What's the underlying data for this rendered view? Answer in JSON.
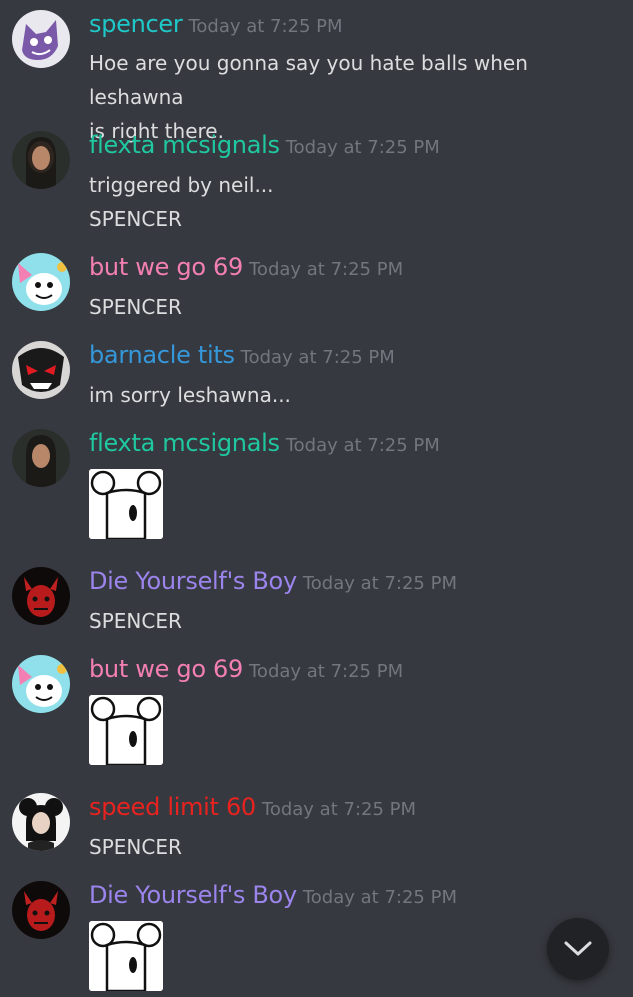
{
  "messages": [
    {
      "username": "spencer",
      "color": "#1fc8c8",
      "timestamp": "Today at 7:25 PM",
      "lines": [
        "Hoe are you gonna say you hate balls when leshawna",
        "is right there."
      ],
      "avatar": "purple-cat-avatar"
    },
    {
      "username": "flexta mcsignals",
      "color": "#1fc8a0",
      "timestamp": "Today at 7:25 PM",
      "lines": [
        "triggered by neil...",
        "SPENCER"
      ],
      "avatar": "photo-woman-avatar"
    },
    {
      "username": "but we go 69",
      "color": "#f47fb2",
      "timestamp": "Today at 7:25 PM",
      "lines": [
        "SPENCER"
      ],
      "avatar": "cartoon-cat-avatar"
    },
    {
      "username": "barnacle tits",
      "color": "#3498db",
      "timestamp": "Today at 7:25 PM",
      "lines": [
        "im sorry leshawna..."
      ],
      "avatar": "villain-mask-avatar"
    },
    {
      "username": "flexta mcsignals",
      "color": "#1fc8a0",
      "timestamp": "Today at 7:25 PM",
      "lines": [],
      "attachment": "mouse-sketch-image",
      "avatar": "photo-woman-avatar"
    },
    {
      "username": "Die Yourself's Boy",
      "color": "#9b84ec",
      "timestamp": "Today at 7:25 PM",
      "lines": [
        "SPENCER"
      ],
      "avatar": "red-demon-avatar"
    },
    {
      "username": "but we go 69",
      "color": "#f47fb2",
      "timestamp": "Today at 7:25 PM",
      "lines": [],
      "attachment": "mouse-sketch-image",
      "avatar": "cartoon-cat-avatar"
    },
    {
      "username": "speed limit 60",
      "color": "#e8231f",
      "timestamp": "Today at 7:25 PM",
      "lines": [
        "SPENCER"
      ],
      "avatar": "dark-hair-girl-avatar"
    },
    {
      "username": "Die Yourself's Boy",
      "color": "#9b84ec",
      "timestamp": "Today at 7:25 PM",
      "lines": [],
      "attachment": "mouse-sketch-image",
      "avatar": "red-demon-avatar"
    }
  ],
  "scroll_button": {
    "icon": "chevron-down-icon"
  }
}
